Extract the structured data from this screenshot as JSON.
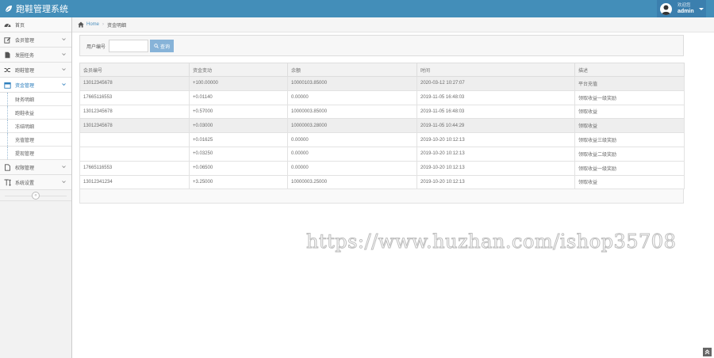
{
  "app": {
    "title": "跑鞋管理系统"
  },
  "user": {
    "welcome": "欢迎您",
    "name": "admin"
  },
  "sidebar": {
    "items": [
      {
        "label": "首页",
        "icon": "tachometer-icon"
      },
      {
        "label": "会员管理",
        "icon": "edit-icon"
      },
      {
        "label": "发圈任务",
        "icon": "file-icon"
      },
      {
        "label": "跑鞋管理",
        "icon": "shuffle-icon"
      },
      {
        "label": "资金管理",
        "icon": "calendar-icon"
      },
      {
        "label": "权限管理",
        "icon": "file-alt-icon"
      },
      {
        "label": "系统设置",
        "icon": "text-height-icon"
      }
    ],
    "sub_items": [
      "财务明细",
      "跑鞋收益",
      "冻结明细",
      "充值管理",
      "提现管理"
    ],
    "collapse_icon": "«"
  },
  "breadcrumb": {
    "home": "Home",
    "current": "资金明细"
  },
  "search": {
    "label": "用户编号",
    "value": "",
    "placeholder": "",
    "button": "查询"
  },
  "table": {
    "headers": [
      "会员编号",
      "资金变动",
      "余额",
      "时间",
      "描述"
    ],
    "rows": [
      [
        "13012345678",
        "+100.00000",
        "10000103.85000",
        "2020-03-12 10:27:07",
        "平台充值"
      ],
      [
        "17665116553",
        "+0.01140",
        "0.00000",
        "2019-11-05 16:48:03",
        "领取收益一级奖励"
      ],
      [
        "13012345678",
        "+0.57000",
        "10000003.85000",
        "2019-11-05 16:48:03",
        "领取收益"
      ],
      [
        "13012345678",
        "+0.03000",
        "10000003.28000",
        "2019-11-05 10:44:29",
        "领取收益"
      ],
      [
        "",
        "+0.01625",
        "0.00000",
        "2019-10-20 10:12:13",
        "领取收益三级奖励"
      ],
      [
        "",
        "+0.03250",
        "0.00000",
        "2019-10-20 10:12:13",
        "领取收益二级奖励"
      ],
      [
        "17665116553",
        "+0.06500",
        "0.00000",
        "2019-10-20 10:12:13",
        "领取收益一级奖励"
      ],
      [
        "13012341234",
        "+3.25000",
        "10000003.25000",
        "2019-10-20 10:12:13",
        "领取收益"
      ]
    ]
  },
  "watermark": "https://www.huzhan.com/ishop35708",
  "colors": {
    "header": "#438eb9",
    "accent": "#2b7dbc",
    "search_button": "#87b3d8"
  }
}
